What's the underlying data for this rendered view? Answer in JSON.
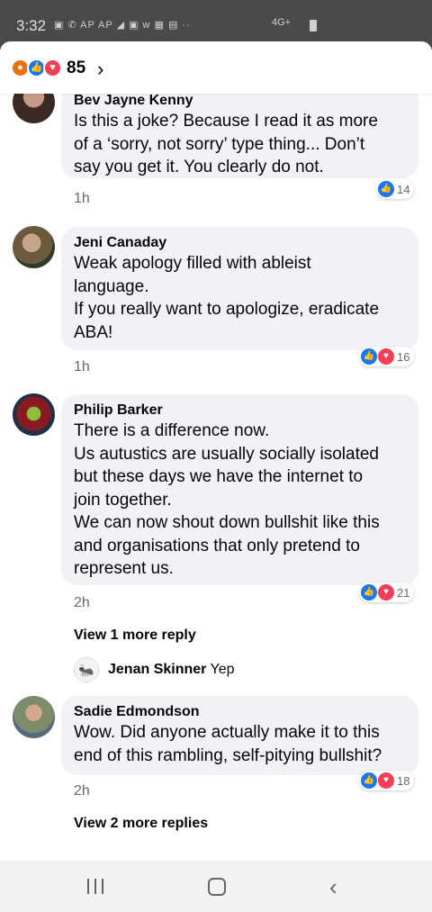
{
  "status": {
    "time": "3:32",
    "icons_left": "▣ ✆ AP AP ◢ ▣ w ▦ ▤ ··",
    "network": "4G+"
  },
  "header": {
    "reaction_count": "85",
    "reactions": [
      "angry",
      "like",
      "love"
    ]
  },
  "comments": [
    {
      "author": "Bev Jayne Kenny",
      "text": "Is this a joke? Because I read it as more\nof a ‘sorry, not sorry’ type thing... Don’t\nsay you get it. You clearly do not.",
      "time": "1h",
      "reaction_count": "14",
      "reactions": [
        "like"
      ]
    },
    {
      "author": "Jeni Canaday",
      "text": "Weak apology filled with ableist\nlanguage.\nIf you really want to apologize, eradicate\nABA!",
      "time": "1h",
      "reaction_count": "16",
      "reactions": [
        "like",
        "love"
      ]
    },
    {
      "author": "Philip Barker",
      "text": "There is a difference now.\nUs autustics are usually socially isolated\nbut these days we have the internet to\njoin together.\nWe can now shout down bullshit like this\nand organisations that only pretend to\nrepresent us.",
      "time": "2h",
      "reaction_count": "21",
      "reactions": [
        "like",
        "love"
      ],
      "view_more": "View 1 more reply",
      "reply": {
        "author": "Jenan Skinner",
        "text": "Yep"
      }
    },
    {
      "author": "Sadie Edmondson",
      "text": "Wow. Did anyone actually make it to this\nend of this rambling, self-pitying bullshit?",
      "time": "2h",
      "reaction_count": "18",
      "reactions": [
        "like",
        "love"
      ],
      "view_more": "View 2 more replies"
    }
  ],
  "colors": {
    "like": "#1877f2",
    "love": "#f33e58",
    "angry": "#e9710f",
    "bubble": "#f0f2f5"
  }
}
